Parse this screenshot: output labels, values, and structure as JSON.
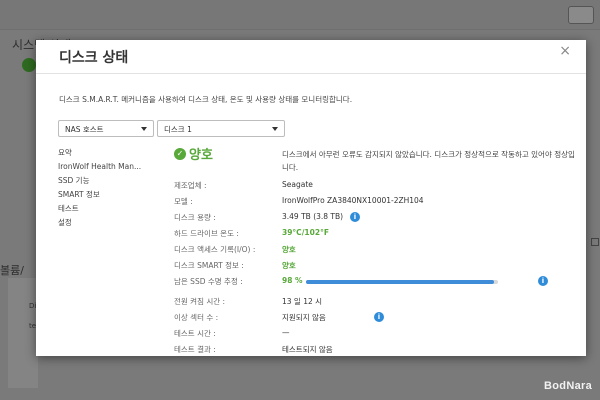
{
  "background": {
    "title": "시스템 상태",
    "volume_label": "볼륨/",
    "rows": [
      "Di",
      "te"
    ],
    "right_label": "류"
  },
  "modal": {
    "title": "디스크 상태",
    "description": "디스크 S.M.A.R.T. 메커니즘을 사용하여 디스크 상태, 온도 및 사용량 상태를 모니터링합니다.",
    "host_select": "NAS 호스트",
    "disk_select": "디스크 1",
    "nav": [
      {
        "label": "요약"
      },
      {
        "label": "IronWolf Health Man..."
      },
      {
        "label": "SSD 기능"
      },
      {
        "label": "SMART 정보"
      },
      {
        "label": "테스트"
      },
      {
        "label": "설정"
      }
    ],
    "status": "양호",
    "status_message": "디스크에서 아무런 오류도 감지되지 않았습니다. 디스크가 정상적으로 작동하고 있어야 정상입니다.",
    "info": [
      {
        "key": "제조업체 :",
        "value": "Seagate"
      },
      {
        "key": "모델 :",
        "value": "IronWolfPro ZA3840NX10001-2ZH104"
      },
      {
        "key": "디스크 용량 :",
        "value": "3.49 TB (3.8 TB)"
      },
      {
        "key": "하드 드라이브 온도 :",
        "value": "39°C/102°F"
      },
      {
        "key": "디스크 액세스 기록(I/O) :",
        "value": "양호"
      },
      {
        "key": "디스크 SMART 정보 :",
        "value": "양호"
      },
      {
        "key": "남은 SSD 수명 추정 :",
        "value": "98 %",
        "percent": 98
      },
      {
        "key": "전원 켜짐 시간 :",
        "value": "13 일 12 시"
      },
      {
        "key": "이상 섹터 수 :",
        "value": "지원되지 않음"
      },
      {
        "key": "테스트 시간 :",
        "value": "—"
      },
      {
        "key": "테스트 결과 :",
        "value": "테스트되지 않음"
      }
    ],
    "colors": {
      "good": "#58a83a",
      "accent": "#2f8cd8"
    }
  },
  "watermark": "BodNara"
}
